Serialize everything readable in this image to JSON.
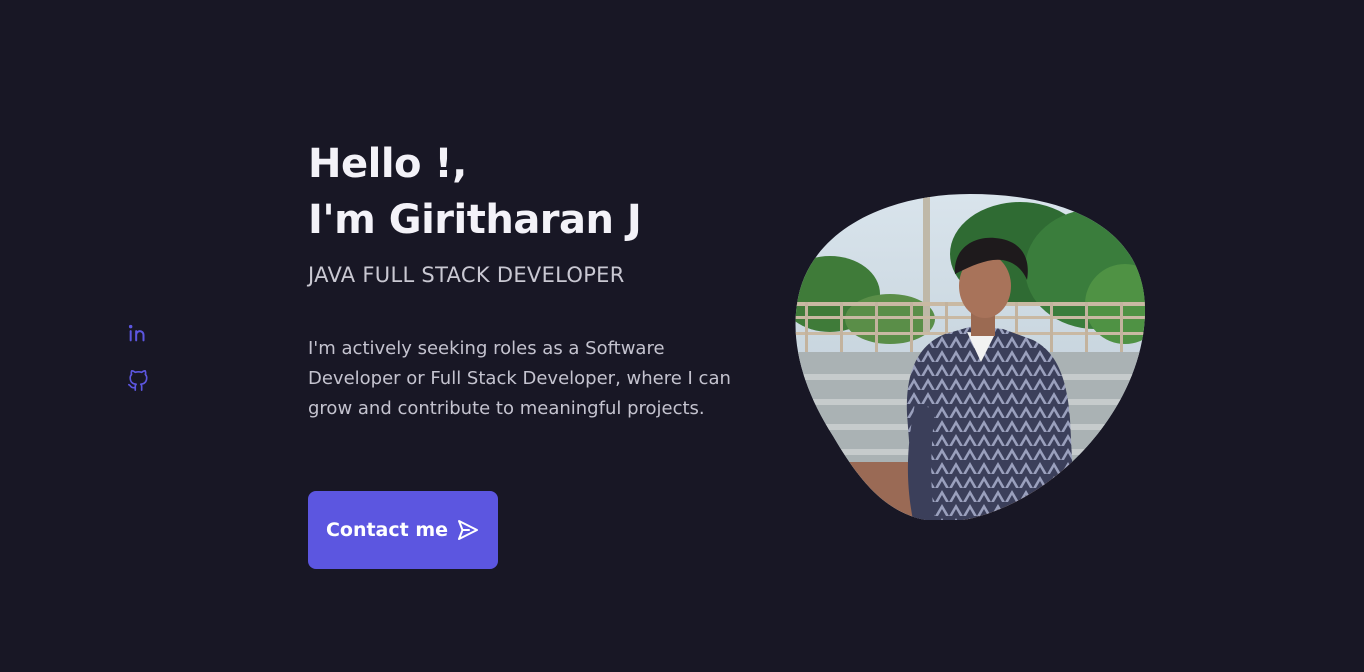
{
  "hero": {
    "greeting_line1": "Hello !,",
    "greeting_line2": "I'm Giritharan J",
    "role": "JAVA FULL STACK DEVELOPER",
    "description": "I'm actively seeking roles as a Software Developer or Full Stack Developer, where I can grow and contribute to meaningful projects.",
    "contact_label": "Contact me",
    "contact_icon": "send-icon"
  },
  "social": {
    "links": [
      {
        "icon": "linkedin-icon",
        "label": "LinkedIn"
      },
      {
        "icon": "github-icon",
        "label": "GitHub"
      }
    ]
  },
  "profile_photo": {
    "shape": "blob",
    "alt": ""
  },
  "colors": {
    "background": "#181725",
    "accent": "#5c56e0",
    "heading": "#f3f2f8",
    "text": "#c4c3cf"
  }
}
